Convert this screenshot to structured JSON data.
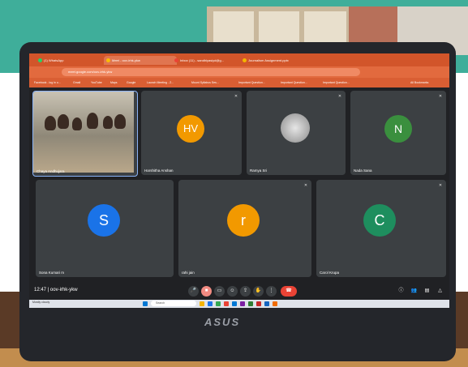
{
  "browser": {
    "tabs": [
      {
        "label": "(1) WhatsApp",
        "active": false
      },
      {
        "label": "Meet - oov-irhk-ykw",
        "active": true
      },
      {
        "label": "Inbox (11) - sandhiyasiyd@g...",
        "active": false
      },
      {
        "label": "Journalism Assignment.pptx",
        "active": false
      }
    ],
    "url": "meet.google.com/oov-irhk-ykw",
    "bookmarks": [
      "Facebook - log in o...",
      "Gmail",
      "YouTube",
      "Maps",
      "Google",
      "Launch Meeting - Z...",
      "Mount Syllabus Ses...",
      "Important Question...",
      "Important Question...",
      "Important Question...",
      "All Bookmarks"
    ]
  },
  "meet": {
    "participants": [
      {
        "name": "Chaya Andhujara",
        "initials": "",
        "type": "video",
        "color": ""
      },
      {
        "name": "Harshitha Anshan",
        "initials": "HV",
        "type": "avatar",
        "color": "#f29900"
      },
      {
        "name": "Ramya Sri",
        "initials": "",
        "type": "photo",
        "color": ""
      },
      {
        "name": "Nada Sana",
        "initials": "N",
        "type": "avatar",
        "color": "#3a8f3e"
      },
      {
        "name": "Sona Kumari m",
        "initials": "S",
        "type": "avatar",
        "color": "#1a73e8"
      },
      {
        "name": "rahi jain",
        "initials": "r",
        "type": "avatar",
        "color": "#f29900"
      },
      {
        "name": "Carol Krupa",
        "initials": "C",
        "type": "avatar",
        "color": "#1e8e5e"
      }
    ],
    "time": "12:47",
    "meeting_code": "oov-irhk-ykw"
  },
  "taskbar": {
    "search_label": "Search",
    "weather": "Mostly cloudy",
    "brand": "ASUS"
  }
}
